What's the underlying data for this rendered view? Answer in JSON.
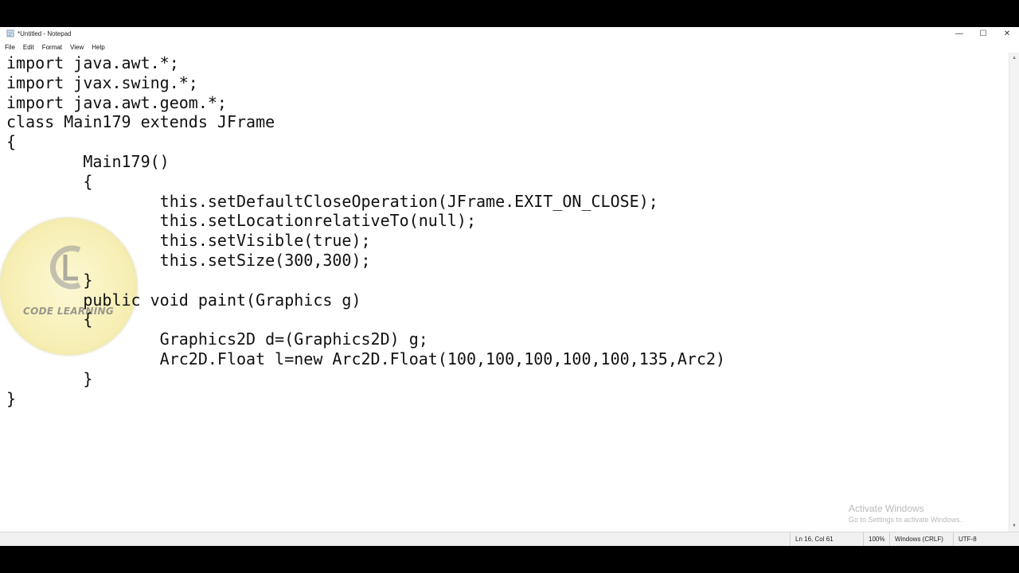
{
  "window": {
    "title": "*Untitled - Notepad",
    "icon": "notepad-icon",
    "controls": {
      "minimize": "—",
      "maximize": "☐",
      "close": "✕"
    }
  },
  "menu": {
    "items": [
      "File",
      "Edit",
      "Format",
      "View",
      "Help"
    ]
  },
  "editor": {
    "lines": [
      "import java.awt.*;",
      "import jvax.swing.*;",
      "import java.awt.geom.*;",
      "class Main179 extends JFrame",
      "{",
      "\tMain179()",
      "\t{",
      "\t\tthis.setDefaultCloseOperation(JFrame.EXIT_ON_CLOSE);",
      "\t\tthis.setLocationrelativeTo(null);",
      "\t\tthis.setVisible(true);",
      "\t\tthis.setSize(300,300);",
      "\t}",
      "\tpublic void paint(Graphics g)",
      "\t{",
      "\t\tGraphics2D d=(Graphics2D) g;",
      "\t\tArc2D.Float l=new Arc2D.Float(100,100,100,100,100,135,Arc2)",
      "\t}",
      "}"
    ]
  },
  "watermark": {
    "text": "CODE LEARNING"
  },
  "activation": {
    "title": "Activate Windows",
    "subtitle": "Go to Settings to activate Windows."
  },
  "status": {
    "position": "Ln 16, Col 61",
    "zoom": "100%",
    "line_ending": "Windows (CRLF)",
    "encoding": "UTF-8"
  },
  "colors": {
    "background": "#ffffff",
    "text": "#111111",
    "statusbar": "#f0f0f0",
    "watermark": "#f4eaa0"
  }
}
